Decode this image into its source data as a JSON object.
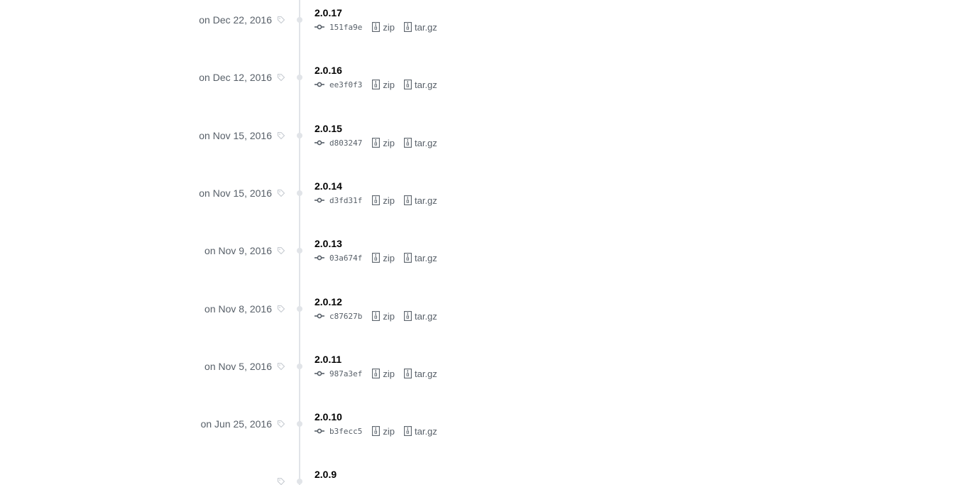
{
  "releases": [
    {
      "date": "on Dec 22, 2016",
      "tag": "2.0.17",
      "sha": "151fa9e",
      "zip": "zip",
      "tar": "tar.gz"
    },
    {
      "date": "on Dec 12, 2016",
      "tag": "2.0.16",
      "sha": "ee3f0f3",
      "zip": "zip",
      "tar": "tar.gz"
    },
    {
      "date": "on Nov 15, 2016",
      "tag": "2.0.15",
      "sha": "d803247",
      "zip": "zip",
      "tar": "tar.gz"
    },
    {
      "date": "on Nov 15, 2016",
      "tag": "2.0.14",
      "sha": "d3fd31f",
      "zip": "zip",
      "tar": "tar.gz"
    },
    {
      "date": "on Nov 9, 2016",
      "tag": "2.0.13",
      "sha": "03a674f",
      "zip": "zip",
      "tar": "tar.gz"
    },
    {
      "date": "on Nov 8, 2016",
      "tag": "2.0.12",
      "sha": "c87627b",
      "zip": "zip",
      "tar": "tar.gz"
    },
    {
      "date": "on Nov 5, 2016",
      "tag": "2.0.11",
      "sha": "987a3ef",
      "zip": "zip",
      "tar": "tar.gz"
    },
    {
      "date": "on Jun 25, 2016",
      "tag": "2.0.10",
      "sha": "b3fecc5",
      "zip": "zip",
      "tar": "tar.gz"
    },
    {
      "date": "",
      "tag": "2.0.9",
      "sha": "",
      "zip": "",
      "tar": ""
    }
  ],
  "icons": {
    "tag": "tag-icon",
    "commit": "git-commit-icon",
    "file": "file-zip-icon"
  },
  "colors": {
    "muted": "#586069",
    "line": "#e1e4e8",
    "title": "#000000"
  }
}
